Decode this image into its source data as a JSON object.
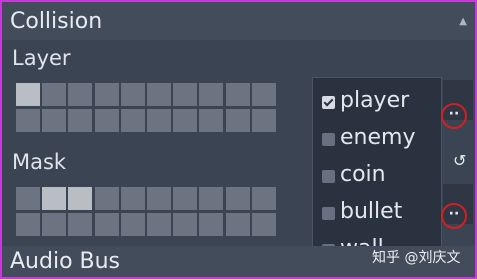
{
  "sections": {
    "collision_title": "Collision",
    "layer_label": "Layer",
    "mask_label": "Mask",
    "audio_bus_title": "Audio Bus"
  },
  "layer_bits": [
    1,
    0,
    0,
    0,
    0,
    0,
    0,
    0,
    0,
    0,
    0,
    0,
    0,
    0,
    0,
    0,
    0,
    0,
    0,
    0
  ],
  "mask_bits": [
    0,
    1,
    1,
    0,
    0,
    0,
    0,
    0,
    0,
    0,
    0,
    0,
    0,
    0,
    0,
    0,
    0,
    0,
    0,
    0
  ],
  "popup": {
    "items": [
      {
        "label": "player",
        "checked": true
      },
      {
        "label": "enemy",
        "checked": false
      },
      {
        "label": "coin",
        "checked": false
      },
      {
        "label": "bullet",
        "checked": false
      },
      {
        "label": "wall",
        "checked": false
      }
    ]
  },
  "buttons": {
    "layer_more": "··",
    "mask_more": "··",
    "reset_icon": "↺"
  },
  "watermark": "知乎 @刘庆文",
  "colors": {
    "highlight_circle": "#d41e22",
    "frame_border": "#c63bd6"
  }
}
